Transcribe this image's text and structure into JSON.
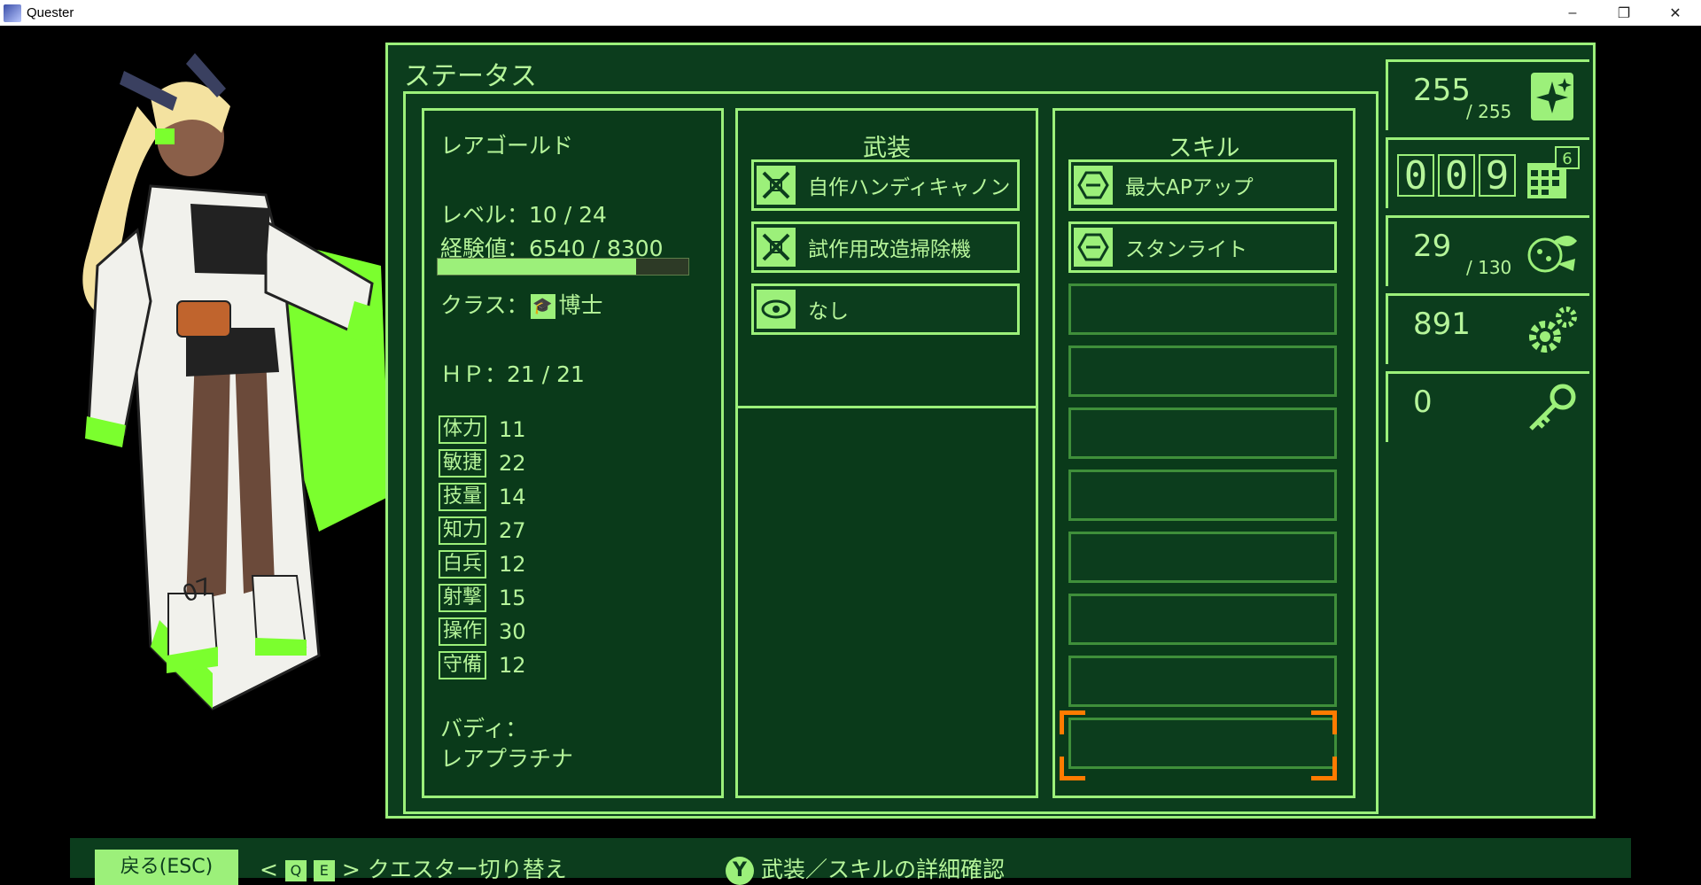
{
  "window": {
    "title": "Quester",
    "minimize_icon": "–",
    "restore_icon": "❐",
    "close_icon": "✕"
  },
  "status": {
    "title": "ステータス",
    "profile": {
      "name": "レアゴールド",
      "level": "レベル：10 / 24",
      "exp": "経験値：6540 / 8300",
      "exp_fraction": 0.79,
      "class_prefix": "クラス：",
      "class_name": "博士",
      "hp": "ＨＰ：21 / 21",
      "stats": [
        {
          "label": "体力",
          "value": "11"
        },
        {
          "label": "敏捷",
          "value": "22"
        },
        {
          "label": "技量",
          "value": "14"
        },
        {
          "label": "知力",
          "value": "27"
        },
        {
          "label": "白兵",
          "value": "12"
        },
        {
          "label": "射撃",
          "value": "15"
        },
        {
          "label": "操作",
          "value": "30"
        },
        {
          "label": "守備",
          "value": "12"
        }
      ],
      "buddy_label": "バディ：",
      "buddy_name": "レアプラチナ"
    },
    "weapons": {
      "header": "武装",
      "items": [
        {
          "label": "自作ハンディキャノン",
          "icon": "weapon-icon"
        },
        {
          "label": "試作用改造掃除機",
          "icon": "weapon-icon"
        },
        {
          "label": "なし",
          "icon": "accessory-icon"
        }
      ]
    },
    "skills": {
      "header": "スキル",
      "items": [
        {
          "label": "最大APアップ",
          "icon": "skill-icon"
        },
        {
          "label": "スタンライト",
          "icon": "skill-icon"
        }
      ],
      "empty_slots": 8
    }
  },
  "resources": {
    "ap": {
      "value": "255",
      "max": "/ 255",
      "icon": "sparkle-card-icon"
    },
    "day_counter": {
      "digits": [
        "0",
        "0",
        "9"
      ],
      "badge": "6",
      "icon": "calendar-icon"
    },
    "food": {
      "value": "29",
      "max": "/ 130",
      "icon": "food-icon"
    },
    "parts": {
      "value": "891",
      "icon": "gears-icon"
    },
    "keys": {
      "value": "0",
      "icon": "key-icon"
    }
  },
  "controls": {
    "back": "戻る(ESC)",
    "switch_keys": [
      "Q",
      "E"
    ],
    "switch_label": "クエスター切り替え",
    "detail_key": "Y",
    "detail_label": "武装／スキルの詳細確認"
  },
  "colors": {
    "accent": "#9cf07a",
    "panel_bg": "#0c3d1d",
    "cursor": "#ff7b00"
  }
}
